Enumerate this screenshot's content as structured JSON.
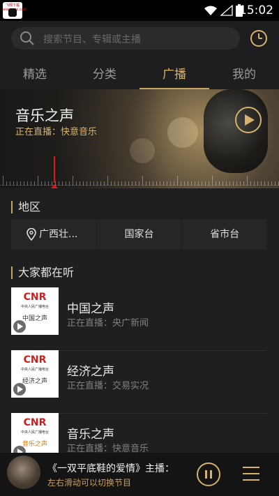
{
  "status_bar": {
    "time": "15:02",
    "badge_text": "飞翔下载 www.xxx.com"
  },
  "search": {
    "placeholder": "搜索节目、专辑或主播"
  },
  "tabs": [
    {
      "label": "精选",
      "active": false
    },
    {
      "label": "分类",
      "active": false
    },
    {
      "label": "广播",
      "active": true
    },
    {
      "label": "我的",
      "active": false
    }
  ],
  "hero": {
    "title": "音乐之声",
    "subtitle": "正在直播：快意音乐"
  },
  "region": {
    "title": "地区",
    "items": [
      {
        "label": "广西壮..."
      },
      {
        "label": "国家台"
      },
      {
        "label": "省市台"
      }
    ]
  },
  "popular": {
    "title": "大家都在听",
    "items": [
      {
        "title": "中国之声",
        "subtitle": "正在直播：央广新闻",
        "cover_logo": "CNR",
        "cover_sub": "中央人民广播电台",
        "cover_name": "中国之声"
      },
      {
        "title": "经济之声",
        "subtitle": "正在直播：交易实况",
        "cover_logo": "CNR",
        "cover_sub": "中央人民广播电台",
        "cover_name": "经济之声"
      },
      {
        "title": "音乐之声",
        "subtitle": "正在直播：快意音乐",
        "cover_logo": "CNR",
        "cover_sub": "中央人民广播电台",
        "cover_name": "音乐之声"
      }
    ]
  },
  "player": {
    "title": "《一双平底鞋的爱情》主播：",
    "subtitle": "左右滑动可以切换节目"
  },
  "colors": {
    "accent": "#d6b26a",
    "background": "#1f1f21",
    "needle": "#e01818"
  },
  "icons": {
    "search": "search-icon",
    "history": "clock-icon",
    "hero_play": "play-icon",
    "region_pin": "location-pin-icon",
    "cover_play": "play-icon",
    "pause": "pause-icon",
    "playlist": "list-icon"
  }
}
